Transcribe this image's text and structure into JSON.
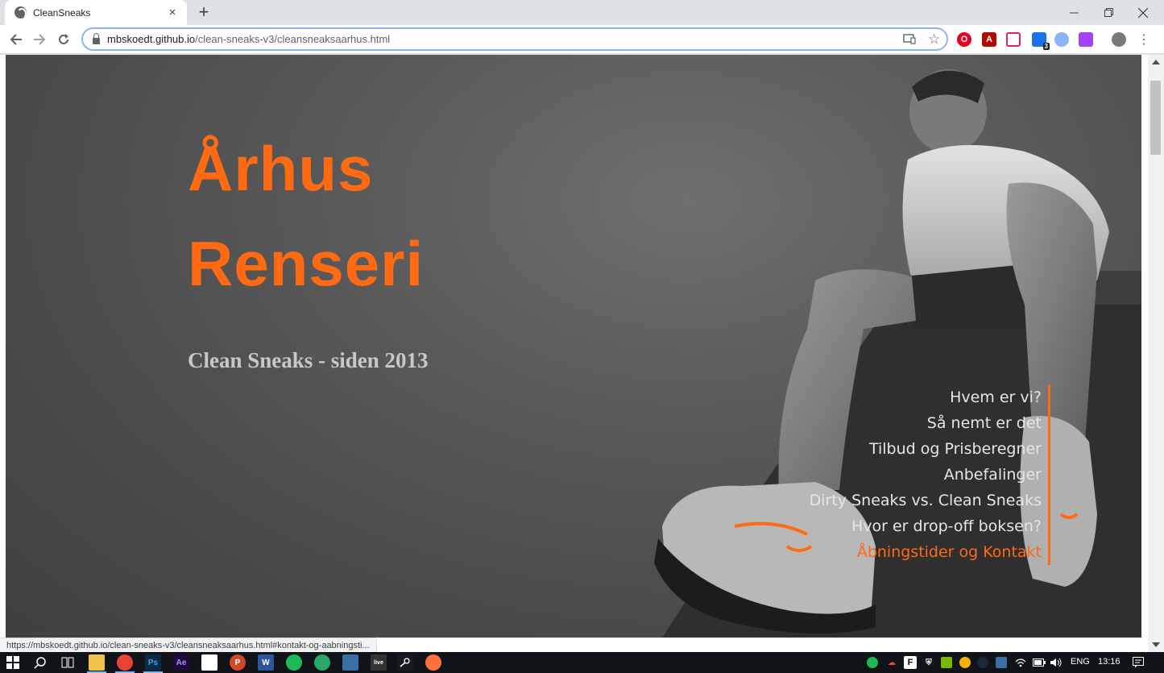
{
  "browser": {
    "tab_title": "CleanSneaks",
    "tab_close": "×",
    "new_tab": "+",
    "url_host": "mbskoedt.github.io",
    "url_path": "/clean-sneaks-v3/cleansneaksaarhus.html",
    "extensions_badge": "3",
    "accent": "#8ab4f8"
  },
  "hero": {
    "title_line1": "Århus",
    "title_line2": "Renseri",
    "subtitle": "Clean Sneaks - siden 2013",
    "accent_color": "#ff6a13"
  },
  "nav": {
    "items": [
      {
        "label": "Hvem er vi?"
      },
      {
        "label": "Så nemt er det"
      },
      {
        "label": "Tilbud og Prisberegner"
      },
      {
        "label": "Anbefalinger"
      },
      {
        "label": "Dirty Sneaks vs. Clean Sneaks"
      },
      {
        "label": "Hvor er drop-off boksen?"
      },
      {
        "label": "Åbningstider og Kontakt"
      }
    ],
    "active_index": 6
  },
  "status_url": "https://mbskoedt.github.io/clean-sneaks-v3/cleansneaksaarhus.html#kontakt-og-aabningsti...",
  "taskbar": {
    "language": "ENG",
    "time": "13:16"
  }
}
